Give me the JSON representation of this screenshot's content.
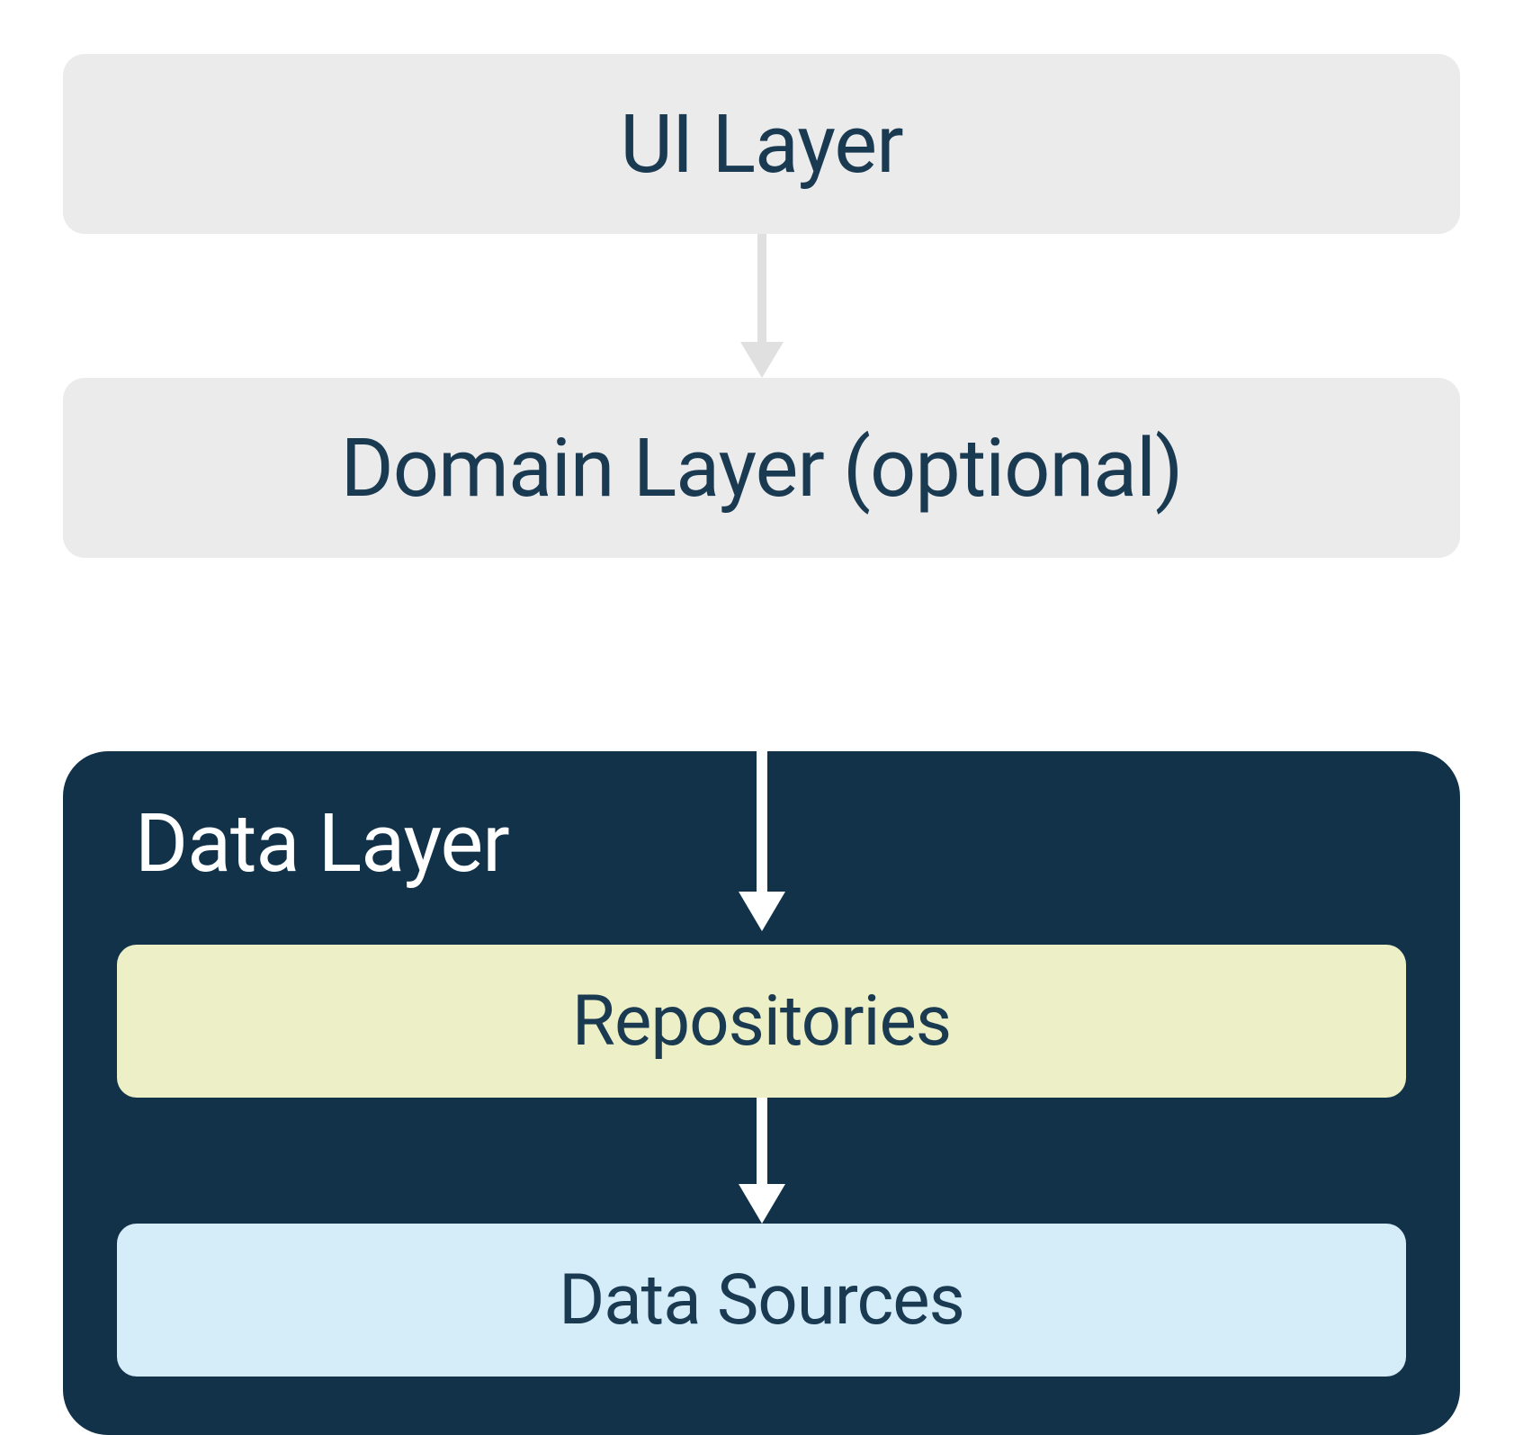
{
  "layers": {
    "ui": "UI Layer",
    "domain": "Domain Layer (optional)",
    "data": {
      "title": "Data Layer",
      "repositories": "Repositories",
      "dataSources": "Data Sources"
    }
  },
  "colors": {
    "lightGray": "#ebebeb",
    "darkNavy": "#123249",
    "textNavy": "#1a3a52",
    "paleYellow": "#edf0c6",
    "paleBlue": "#d5ecf9",
    "white": "#ffffff",
    "arrowLight": "#e0e0e0"
  }
}
